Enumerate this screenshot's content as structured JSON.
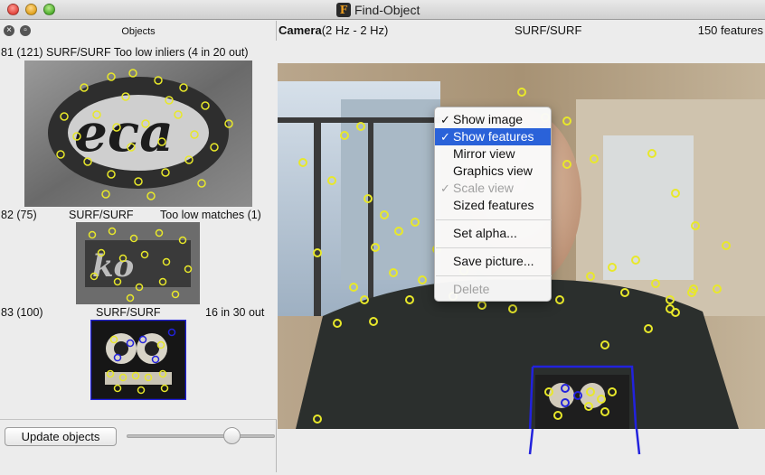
{
  "window": {
    "title": "Find-Object"
  },
  "objects_panel": {
    "title": "Objects",
    "items": [
      {
        "id_text": "81 (121)",
        "algo": "SURF/SURF",
        "status": "Too low inliers (4 in 20 out)"
      },
      {
        "id_text": "82 (75)",
        "algo": "SURF/SURF",
        "status": "Too low matches (1)"
      },
      {
        "id_text": "83 (100)",
        "algo": "SURF/SURF",
        "status": "16 in 30 out"
      }
    ],
    "update_button": "Update objects",
    "slider_value": 0.75
  },
  "camera": {
    "label": "Camera",
    "rate": "(2 Hz - 2 Hz)",
    "algo": "SURF/SURF",
    "features": "150 features"
  },
  "context_menu": {
    "items": [
      {
        "label": "Show image",
        "checked": true,
        "enabled": true
      },
      {
        "label": "Show features",
        "checked": true,
        "enabled": true
      },
      {
        "label": "Mirror view",
        "checked": false,
        "enabled": true
      },
      {
        "label": "Graphics view",
        "checked": false,
        "enabled": true
      },
      {
        "label": "Scale view",
        "checked": true,
        "enabled": false
      },
      {
        "label": "Sized features",
        "checked": false,
        "enabled": true
      },
      {
        "label": "Set alpha...",
        "checked": false,
        "enabled": true
      },
      {
        "label": "Save picture...",
        "checked": false,
        "enabled": true
      },
      {
        "label": "Delete",
        "checked": false,
        "enabled": false
      }
    ],
    "check_glyph": "✓"
  },
  "colors": {
    "feature": "#e8e82a",
    "detection_box": "#2222dd",
    "menu_highlight": "#2a62d9"
  }
}
